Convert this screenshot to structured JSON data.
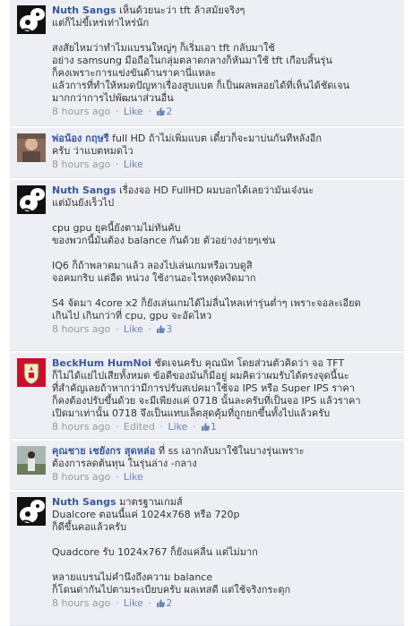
{
  "comments": [
    {
      "author": "Nuth Sangs",
      "text": "เห็นด้วยนะว่า tft ล้าสมัยจริงๆ\nแต่ก็ไม่ขี้เหร่เท่าไหร่นัก\n\nสงสัยไหมว่าทำไมแบรนใหญ่ๆ ก็เริ่มเอา tft กลับมาใช้\nอย่าง samsung มือถือในกลุ่มตลาดกลางก็หันมาใช้ tft เกือบสิ้นรุ่น\nก็คงเพราะการแข่งขันด้านราคานี่แหละ\nแล้วการที่ทำให้หมดปัญหาเรื่องสูบแบต ก็เป็นผลพลอยได้ที่เห็นได้ชัดเจน\nมากกว่าการไปพัฒนาส่วนอื่น",
      "time": "8 hours ago",
      "like": "Like",
      "likes": "2",
      "edited": ""
    },
    {
      "author": "พ่อน้อง กฤษรี",
      "text": "full HD ถ้าไม่เพิ่มแบต เดี๋ยวก็จะมาบ่นกันทีหลังอีก\nครับ ว่าแบตหมดไว",
      "time": "8 hours ago",
      "like": "Like",
      "likes": "",
      "edited": ""
    },
    {
      "author": "Nuth Sangs",
      "text": "เรื่องจอ HD FullHD ผมบอกได้เลยว่ามันเจ๋งนะ\nแต่มันยังเร็วไป\n\ncpu gpu ยุคนี้ยังตามไม่ทันคับ\nของพวกนี้มันต้อง balance กันด้วย ตัวอย่างง่ายๆเช่น\n\nIQ6 ก็ถ้าพลาดมาแล้ว ลองไปเล่นเกมหรือเวบดูสิ\nจอคมกริบ แต่อืด หน่วง ใช้งานอะไรหงุดหงิดมาก\n\nS4 จัดมา 4core x2 ก็ยังเล่นเกมได้ไม่ลื่นไหลเท่ารุ่นต่ำๆ เพราะจอละเอียด\nเกินไป เกินกว่าที่ cpu, gpu จะอัดไหว",
      "time": "8 hours ago",
      "like": "Like",
      "likes": "3",
      "edited": ""
    },
    {
      "author": "BeckHum HumNoi",
      "text": "ชัดเจนครับ คุณนัท โดยส่วนตัวคิดว่า จอ TFT\nก็ไม่ได้แย่ไปเสียทั้งหมด ข้อดีของมันก็มีอยู่ ผมคิดว่าผมรับได้ตรงจุดนี้นะ\nที่สำคัญเลยถ้าหากว่ามีการปรับสเปคมาใช้จอ IPS หรือ Super IPS ราคา\nก็คงต้องปรับขึ้นด้วย จะมีเพียงแค่ 0718 นั้นละครับที่เป็นจอ IPS แล้วราคา\nเปิดมาเท่านั้น 0718 จึงเป็นแทบเล็ตสุดคุ้มที่ถูกยกขึ้นทั้งไปแล้วครับ",
      "time": "8 hours ago",
      "like": "Like",
      "likes": "1",
      "edited": "Edited"
    },
    {
      "author": "คุณชาย เชยังกร สุดหล่อ",
      "text": "ที่ ss เอากลับมาใช้ในบางรุ่นเพราะ\nต้องการลดต้นทุน ในรุ่นล่าง -กลาง",
      "time": "8 hours ago",
      "like": "Like",
      "likes": "",
      "edited": ""
    },
    {
      "author": "Nuth Sangs",
      "text": "มาตรฐานเกมส์\nDualcore ตอนนี้แค่ 1024x768 หรือ 720p\nก็ดีขึ้นคอแล้วครับ\n\nQuadcore รับ 1024x767 ก็ยังแค่ลื่น แต่ไม่มาก\n\nหลายแบรนไม่คำนึงถึงความ balance\nก็โดนด่ากันไปตามระเบียบครับ ผลเทสดี แต่ใช้จริงกระตุก",
      "time": "8 hours ago",
      "like": "Like",
      "likes": "2",
      "edited": ""
    }
  ],
  "colors": {
    "author": "#3b5998",
    "comment_bg": "#edeff4",
    "meta": "#999999"
  },
  "icons": {
    "avatar_default": "cartoon-avatar-icon",
    "like": "thumbs-up-icon"
  }
}
